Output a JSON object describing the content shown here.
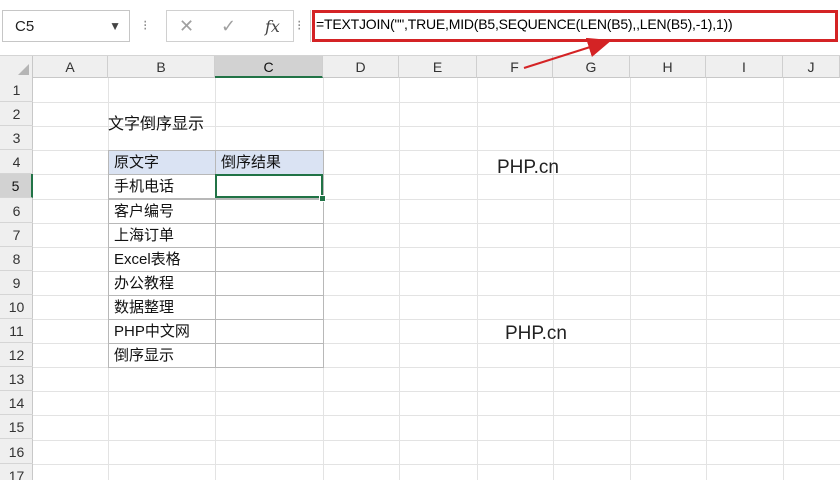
{
  "formula_bar": {
    "name_box": "C5",
    "formula": "=TEXTJOIN(\"\",TRUE,MID(B5,SEQUENCE(LEN(B5),,LEN(B5),-1),1))",
    "fx_label": "fx"
  },
  "columns": [
    "A",
    "B",
    "C",
    "D",
    "E",
    "F",
    "G",
    "H",
    "I",
    "J"
  ],
  "rows": [
    "1",
    "2",
    "3",
    "4",
    "5",
    "6",
    "7",
    "8",
    "9",
    "10",
    "11",
    "12",
    "13",
    "14",
    "15",
    "16",
    "17"
  ],
  "sheet": {
    "title": "文字倒序显示",
    "table": {
      "headers": [
        "原文字",
        "倒序结果"
      ],
      "rows": [
        [
          "手机电话",
          ""
        ],
        [
          "客户编号",
          ""
        ],
        [
          "上海订单",
          ""
        ],
        [
          "Excel表格",
          ""
        ],
        [
          "办公教程",
          ""
        ],
        [
          "数据整理",
          ""
        ],
        [
          "PHP中文网",
          ""
        ],
        [
          "倒序显示",
          ""
        ]
      ]
    },
    "watermark_1": "PHP.cn",
    "watermark_2": "PHP.cn"
  },
  "colors": {
    "selection": "#217346",
    "annotation": "#d42325",
    "table_header": "#dae3f3"
  }
}
